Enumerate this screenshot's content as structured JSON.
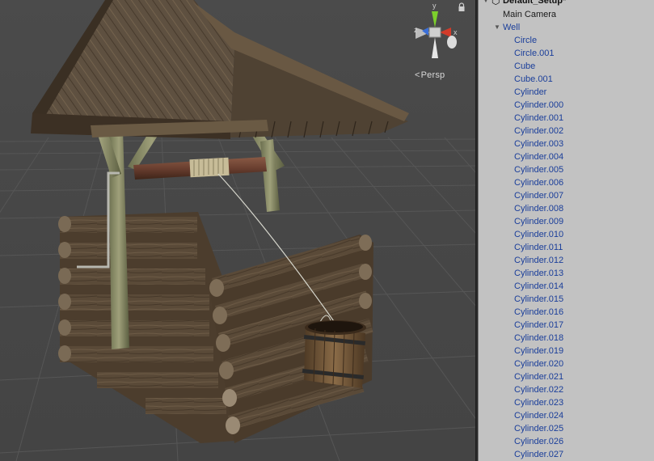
{
  "scene": {
    "projection_label": "Persp",
    "gizmo": {
      "x_label": "x",
      "z_label": "z",
      "y_label": "y"
    },
    "icons": [
      "lock-icon",
      "persp-arrow-icon"
    ]
  },
  "hierarchy": {
    "scene_name": "Default_Setup*",
    "items": [
      {
        "label": "Main Camera",
        "style": "black",
        "indent": 1
      },
      {
        "label": "Well",
        "style": "blue",
        "indent": 1,
        "expanded": true
      },
      {
        "label": "Circle",
        "style": "blue",
        "indent": 2
      },
      {
        "label": "Circle.001",
        "style": "blue",
        "indent": 2
      },
      {
        "label": "Cube",
        "style": "blue",
        "indent": 2
      },
      {
        "label": "Cube.001",
        "style": "blue",
        "indent": 2
      },
      {
        "label": "Cylinder",
        "style": "blue",
        "indent": 2
      },
      {
        "label": "Cylinder.000",
        "style": "blue",
        "indent": 2
      },
      {
        "label": "Cylinder.001",
        "style": "blue",
        "indent": 2
      },
      {
        "label": "Cylinder.002",
        "style": "blue",
        "indent": 2
      },
      {
        "label": "Cylinder.003",
        "style": "blue",
        "indent": 2
      },
      {
        "label": "Cylinder.004",
        "style": "blue",
        "indent": 2
      },
      {
        "label": "Cylinder.005",
        "style": "blue",
        "indent": 2
      },
      {
        "label": "Cylinder.006",
        "style": "blue",
        "indent": 2
      },
      {
        "label": "Cylinder.007",
        "style": "blue",
        "indent": 2
      },
      {
        "label": "Cylinder.008",
        "style": "blue",
        "indent": 2
      },
      {
        "label": "Cylinder.009",
        "style": "blue",
        "indent": 2
      },
      {
        "label": "Cylinder.010",
        "style": "blue",
        "indent": 2
      },
      {
        "label": "Cylinder.011",
        "style": "blue",
        "indent": 2
      },
      {
        "label": "Cylinder.012",
        "style": "blue",
        "indent": 2
      },
      {
        "label": "Cylinder.013",
        "style": "blue",
        "indent": 2
      },
      {
        "label": "Cylinder.014",
        "style": "blue",
        "indent": 2
      },
      {
        "label": "Cylinder.015",
        "style": "blue",
        "indent": 2
      },
      {
        "label": "Cylinder.016",
        "style": "blue",
        "indent": 2
      },
      {
        "label": "Cylinder.017",
        "style": "blue",
        "indent": 2
      },
      {
        "label": "Cylinder.018",
        "style": "blue",
        "indent": 2
      },
      {
        "label": "Cylinder.019",
        "style": "blue",
        "indent": 2
      },
      {
        "label": "Cylinder.020",
        "style": "blue",
        "indent": 2
      },
      {
        "label": "Cylinder.021",
        "style": "blue",
        "indent": 2
      },
      {
        "label": "Cylinder.022",
        "style": "blue",
        "indent": 2
      },
      {
        "label": "Cylinder.023",
        "style": "blue",
        "indent": 2
      },
      {
        "label": "Cylinder.024",
        "style": "blue",
        "indent": 2
      },
      {
        "label": "Cylinder.025",
        "style": "blue",
        "indent": 2
      },
      {
        "label": "Cylinder.026",
        "style": "blue",
        "indent": 2
      },
      {
        "label": "Cylinder.027",
        "style": "blue",
        "indent": 2
      }
    ]
  },
  "colors": {
    "hierarchy_bg": "#c2c2c2",
    "prefab_blue": "#1a3e9a",
    "scene_bg": "#474747",
    "gizmo_x": "#d23b2a",
    "gizmo_y": "#7ccf2c",
    "gizmo_z": "#3a6fd8"
  }
}
